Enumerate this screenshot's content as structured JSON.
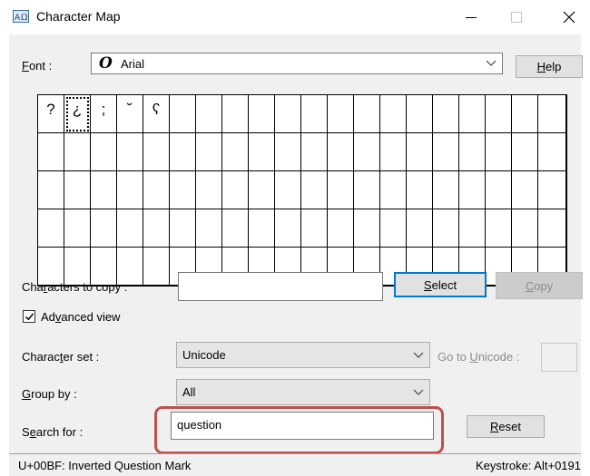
{
  "window": {
    "title": "Character Map",
    "icon": "charmap-app-icon"
  },
  "font": {
    "label_prefix": "",
    "label_mnemonic": "F",
    "label_rest": "ont :",
    "glyph": "O",
    "value": "Arial",
    "help_mnemonic": "H",
    "help_rest": "elp"
  },
  "grid": {
    "columns": 20,
    "rows": 5,
    "selected_index": 1,
    "characters": [
      "?",
      "¿",
      ";",
      "˘",
      "ʕ"
    ]
  },
  "copy": {
    "label_a": "Cha",
    "label_mnemonic": "r",
    "label_b": "acters to copy :",
    "value": "",
    "select_mnemonic": "S",
    "select_rest": "elect",
    "copy_mnemonic": "C",
    "copy_rest": "opy"
  },
  "advanced": {
    "checked": true,
    "label_a": "Ad",
    "label_mnemonic": "v",
    "label_b": "anced view"
  },
  "charset": {
    "label_a": "Charac",
    "label_mnemonic": "t",
    "label_b": "er set :",
    "value": "Unicode",
    "goto_a": "Go to ",
    "goto_mnemonic": "U",
    "goto_b": "nicode :"
  },
  "group": {
    "label_mnemonic": "G",
    "label_rest": "roup by :",
    "value": "All"
  },
  "search": {
    "label_a": "S",
    "label_mnemonic": "e",
    "label_b": "arch for :",
    "value": "question",
    "reset_mnemonic": "R",
    "reset_rest": "eset"
  },
  "status": {
    "left": "U+00BF: Inverted Question Mark",
    "right": "Keystroke: Alt+0191"
  },
  "colors": {
    "accent": "#0078d7",
    "highlight": "#c0504d"
  }
}
